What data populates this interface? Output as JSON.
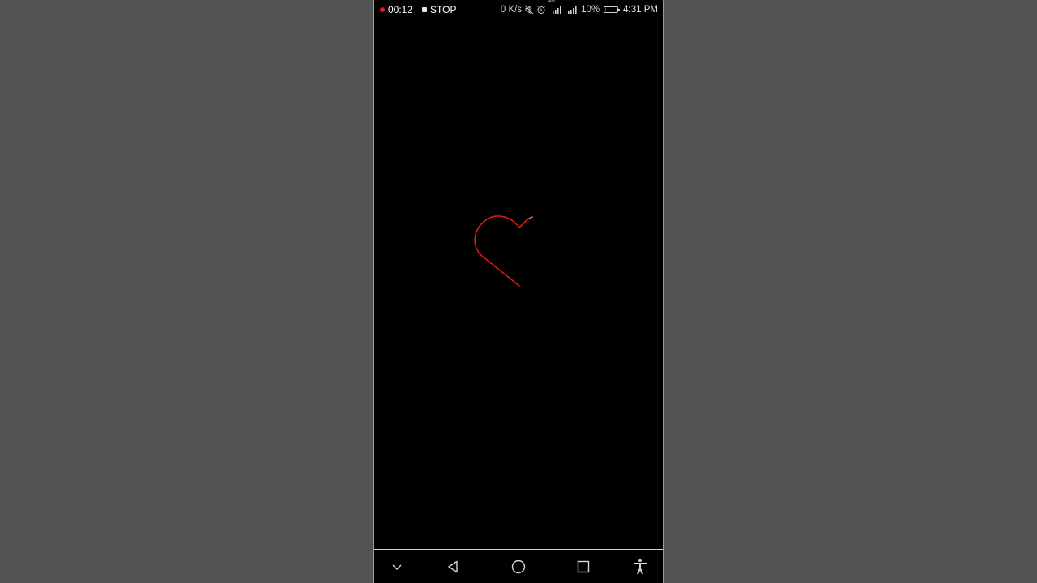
{
  "status_bar": {
    "recording_time": "00:12",
    "stop_label": "STOP",
    "net_speed": "0 K/s",
    "network_type": "4G",
    "battery_percent": "10%",
    "battery_level": 0.1,
    "clock": "4:31 PM",
    "icons": [
      "record-dot-icon",
      "stop-icon",
      "mute-icon",
      "alarm-icon",
      "signal-icon",
      "signal-icon",
      "battery-icon"
    ]
  },
  "canvas": {
    "drawing": "heart-outline",
    "stroke_color": "#e01818",
    "background": "#000000"
  },
  "nav_bar": {
    "buttons": [
      "collapse-chevron",
      "back",
      "home",
      "recents",
      "accessibility"
    ]
  },
  "colors": {
    "outer_background": "#525252",
    "recording_red": "#e02020"
  }
}
